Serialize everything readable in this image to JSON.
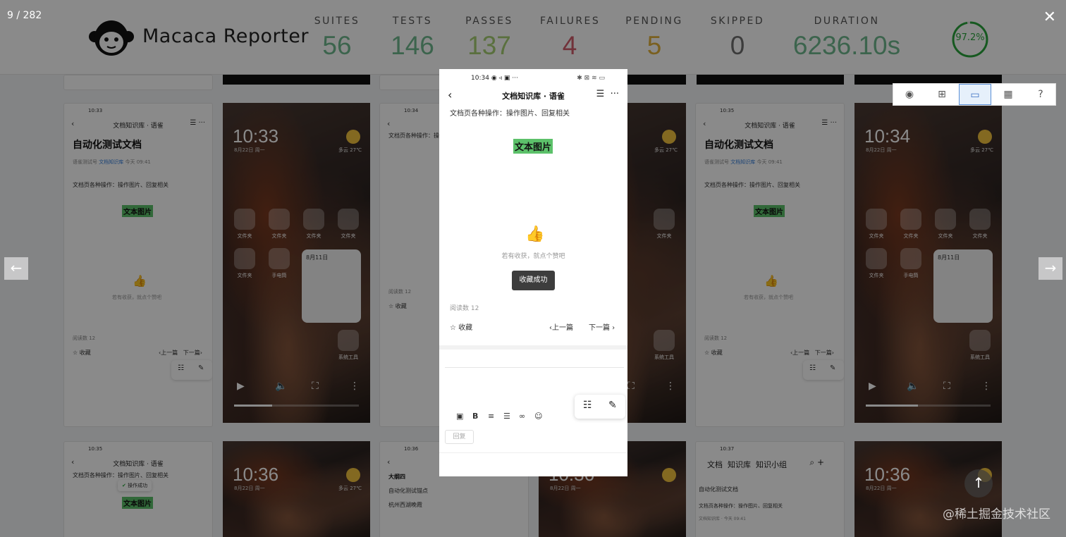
{
  "header": {
    "app_title": "Macaca Reporter",
    "stats": [
      {
        "label": "SUITES",
        "value": "56",
        "color": "#6fb98e"
      },
      {
        "label": "TESTS",
        "value": "146",
        "color": "#6fb98e"
      },
      {
        "label": "PASSES",
        "value": "137",
        "color": "#a6cf73"
      },
      {
        "label": "FAILURES",
        "value": "4",
        "color": "#d15d6b"
      },
      {
        "label": "PENDING",
        "value": "5",
        "color": "#e2b13c"
      },
      {
        "label": "SKIPPED",
        "value": "0",
        "color": "#6f6f6f"
      },
      {
        "label": "DURATION",
        "value": "6236.10s",
        "color": "#6fb98e"
      }
    ],
    "pass_rate": "97.2%",
    "pass_rate_fraction": 0.972,
    "pass_rate_color": "#2aa53c"
  },
  "viewer": {
    "counter": "9 / 282",
    "close_icon": "close-icon",
    "prev_icon": "arrow-left-icon",
    "next_icon": "arrow-right-icon",
    "view_modes": [
      "eye-icon",
      "sitemap-icon",
      "screenshot-icon",
      "table-icon",
      "help-icon"
    ],
    "active_view_mode": "screenshot-icon"
  },
  "main_phone": {
    "status_time": "10:34",
    "status_glyphs": "◉ ◃ ▣ ···",
    "status_right": "✱ ⊠ ≋ ▭",
    "nav_title": "文档知识库 · 语雀",
    "body_text": "文档页各种操作：操作图片、回复相关",
    "highlight_text": "文本图片",
    "like_hint": "若有收获，就点个赞吧",
    "toast": "收藏成功",
    "read_count": "阅读数 12",
    "favorite": "收藏",
    "prev_article": "上一篇",
    "next_article": "下一篇",
    "reply_button": "回复"
  },
  "thumbnails": {
    "doc": {
      "nav_title": "文档知识库 · 语雀",
      "title": "自动化测试文档",
      "meta_author": "语雀测试号",
      "meta_repo": "文档知识库",
      "meta_time": "今天 09:41",
      "body_text": "文档页各种操作：操作图片、回复相关",
      "highlight_text": "文本图片",
      "like_hint": "若有收获，就点个赞吧",
      "read_count": "阅读数 12",
      "favorite": "收藏",
      "prev_article": "上一篇",
      "next_article": "下一篇"
    },
    "wallpaper": {
      "date": "8月22日 周一",
      "weather": "多云 27℃",
      "folder_label": "文件夹",
      "flashlight_label": "手电筒",
      "widget_date": "8月11日",
      "system_tools": "系统工具"
    },
    "times": [
      "10:33",
      "10:34",
      "10:35",
      "10:35",
      "10:36",
      "10:37",
      "10:36",
      "10:35"
    ],
    "row2": {
      "toast": "操作成功",
      "outline_title": "大纲四",
      "outline_item1": "自动化测试锚点",
      "outline_item2": "杭州西湖晚霞",
      "tab_doc": "文档",
      "tab_repo": "知识库",
      "tab_group": "知识小组",
      "doc_title": "自动化测试文档",
      "doc_body": "文档页各种操作：操作图片、回复相关",
      "doc_meta": "文档知识库 · 今天 09:41"
    }
  },
  "watermark": "@稀土掘金技术社区"
}
